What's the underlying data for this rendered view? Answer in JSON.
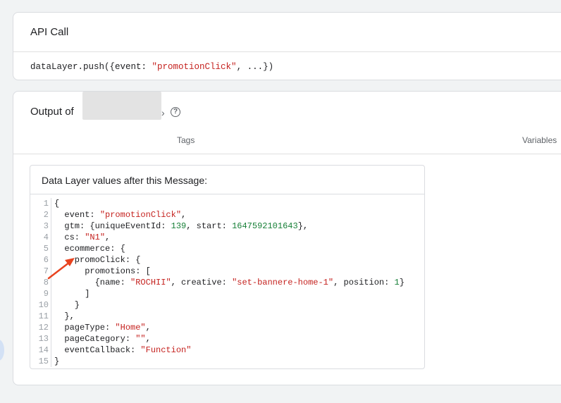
{
  "api_card": {
    "title": "API Call",
    "code": {
      "prefix": "dataLayer.push({event: ",
      "event_value": "\"promotionClick\"",
      "suffix": ", ...})"
    }
  },
  "output_card": {
    "title": "Output of",
    "title_suffix": "›",
    "help_icon": "?",
    "tabs": {
      "tags": "Tags",
      "variables": "Variables"
    },
    "panel_title": "Data Layer values after this Message:",
    "line_numbers": [
      "1",
      "2",
      "3",
      "4",
      "5",
      "6",
      "7",
      "8",
      "9",
      "10",
      "11",
      "12",
      "13",
      "14",
      "15"
    ],
    "code": {
      "l1": "{",
      "l2_key": "  event: ",
      "l2_val": "\"promotionClick\"",
      "l2_end": ",",
      "l3_key": "  gtm: {uniqueEventId: ",
      "l3_num1": "139",
      "l3_mid": ", start: ",
      "l3_num2": "1647592101643",
      "l3_end": "},",
      "l4_key": "  cs: ",
      "l4_val": "\"N1\"",
      "l4_end": ",",
      "l5": "  ecommerce: {",
      "l6": "    promoClick: {",
      "l7": "      promotions: [",
      "l8_a": "        {name: ",
      "l8_name": "\"ROCHII\"",
      "l8_b": ", creative: ",
      "l8_creative": "\"set-bannere-home-1\"",
      "l8_c": ", position: ",
      "l8_pos": "1",
      "l8_d": "}",
      "l9": "      ]",
      "l10": "    }",
      "l11": "  },",
      "l12_key": "  pageType: ",
      "l12_val": "\"Home\"",
      "l12_end": ",",
      "l13_key": "  pageCategory: ",
      "l13_val": "\"\"",
      "l13_end": ",",
      "l14_key": "  eventCallback: ",
      "l14_val": "\"Function\"",
      "l15": "}"
    }
  },
  "colors": {
    "string": "#c5221f",
    "number": "#188038",
    "arrow": "#e8431f"
  },
  "icons": {
    "help": "help-circle-icon",
    "annotation": "red-arrow-annotation"
  }
}
